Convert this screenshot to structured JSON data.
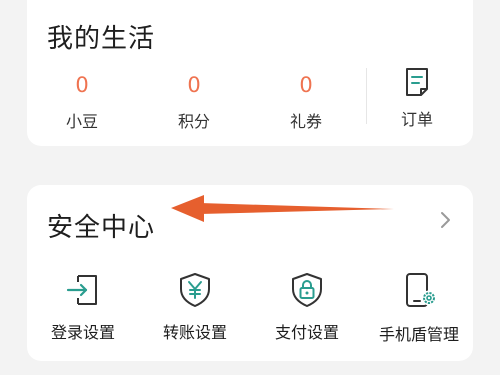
{
  "my_life": {
    "title": "我的生活",
    "stats": [
      {
        "value": "0",
        "label": "小豆"
      },
      {
        "value": "0",
        "label": "积分"
      },
      {
        "value": "0",
        "label": "礼券"
      }
    ],
    "orders_label": "订单"
  },
  "security": {
    "title": "安全中心",
    "tools": [
      {
        "label": "登录设置",
        "icon": "login-icon"
      },
      {
        "label": "转账设置",
        "icon": "shield-yuan-icon"
      },
      {
        "label": "支付设置",
        "icon": "shield-lock-icon"
      },
      {
        "label": "手机盾管理",
        "icon": "phone-gear-icon"
      }
    ]
  },
  "colors": {
    "accent": "#ef7350",
    "icon": "#2a9d8f",
    "annotation_arrow": "#e65f2e",
    "background": "#f3f3f3",
    "card": "#ffffff"
  }
}
